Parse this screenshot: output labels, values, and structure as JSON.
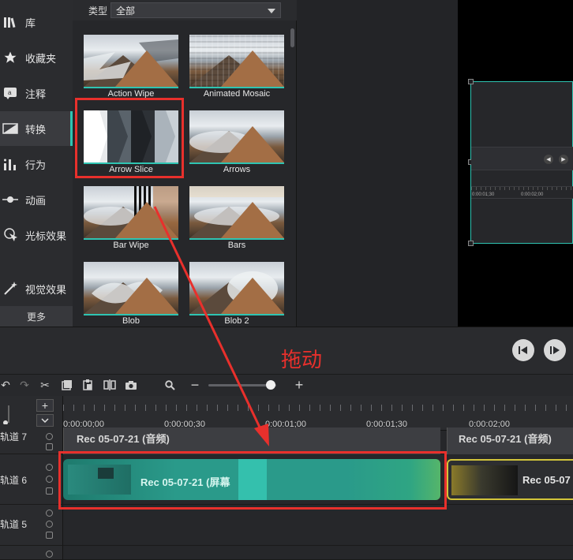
{
  "sidebar": {
    "items": [
      {
        "label": "库",
        "icon": "library-icon"
      },
      {
        "label": "收藏夹",
        "icon": "star-icon"
      },
      {
        "label": "注释",
        "icon": "annotation-icon"
      },
      {
        "label": "转换",
        "icon": "transition-icon"
      },
      {
        "label": "行为",
        "icon": "behavior-icon"
      },
      {
        "label": "动画",
        "icon": "animation-icon"
      },
      {
        "label": "光标效果",
        "icon": "cursor-effect-icon"
      },
      {
        "label": "视觉效果",
        "icon": "visual-effect-icon"
      }
    ],
    "more_label": "更多"
  },
  "library": {
    "type_label": "类型",
    "type_value": "全部",
    "transitions": [
      {
        "name": "Action Wipe"
      },
      {
        "name": "Animated Mosaic"
      },
      {
        "name": "Arrow Slice"
      },
      {
        "name": "Arrows"
      },
      {
        "name": "Bar Wipe"
      },
      {
        "name": "Bars"
      },
      {
        "name": "Blob"
      },
      {
        "name": "Blob 2"
      }
    ]
  },
  "preview": {
    "mini_ticks": [
      "0:00:01;30",
      "0:00:02;00"
    ]
  },
  "annotation": {
    "drag_label": "拖动",
    "color": "#e8302c"
  },
  "timeline": {
    "ruler_labels": [
      "0:00:00;00",
      "0:00:00;30",
      "0:00:01;00",
      "0:00:01;30",
      "0:00:02;00"
    ],
    "tracks": [
      {
        "name": "轨道 7"
      },
      {
        "name": "轨道 6"
      },
      {
        "name": "轨道 5"
      }
    ],
    "audio_clips": [
      "Rec 05-07-21 (音频)",
      "Rec 05-07-21 (音频)"
    ],
    "main_clip": "Rec 05-07-21 (屏幕",
    "second_clip": "Rec 05-07"
  },
  "colors": {
    "accent": "#2fc4b2",
    "clip_teal": "#2a9a8a",
    "clip_yellow": "#d2c43a"
  }
}
